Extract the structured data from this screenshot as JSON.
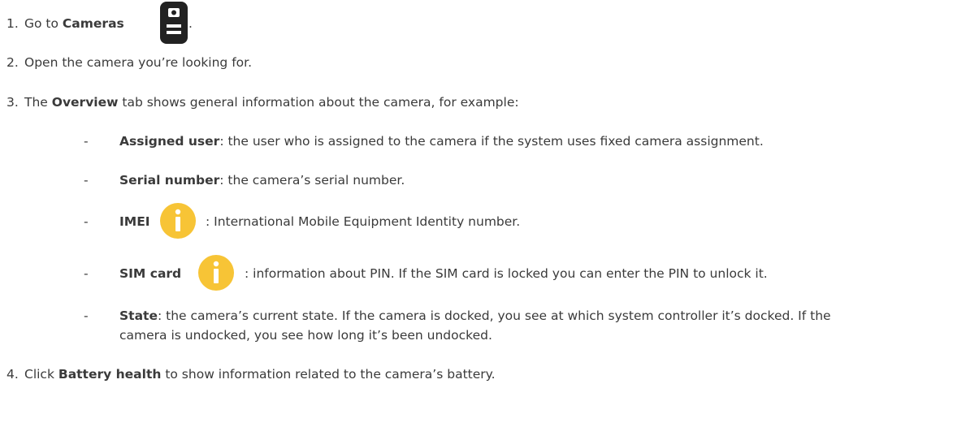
{
  "steps": [
    {
      "num": "1.",
      "pre": "Go to ",
      "bold": "Cameras",
      "post": " ."
    },
    {
      "num": "2.",
      "text": "Open the camera you’re looking for."
    },
    {
      "num": "3.",
      "pre": "The ",
      "bold": "Overview",
      "post": " tab shows general information about the camera, for example:"
    },
    {
      "num": "4.",
      "pre": "Click ",
      "bold": "Battery health",
      "post": " to show information related to the camera’s battery."
    }
  ],
  "items": [
    {
      "dash": "-",
      "bold": "Assigned user",
      "text": ": the user who is assigned to the camera if the system uses fixed camera assignment."
    },
    {
      "dash": "-",
      "bold": "Serial number",
      "text": ": the camera’s serial number."
    },
    {
      "dash": "-",
      "bold": "IMEI",
      "text": ": International Mobile Equipment Identity number."
    },
    {
      "dash": "-",
      "bold": "SIM card",
      "text": ": information about PIN. If the SIM card is locked you can enter the PIN to unlock it."
    },
    {
      "dash": "-",
      "bold": "State",
      "text": ": the camera’s current state. If the camera is docked, you see at which system controller it’s docked. If the",
      "text2": "camera is undocked, you see how long it’s been undocked."
    }
  ],
  "colors": {
    "text": "#3a3a3a",
    "info_icon": "#f7c436",
    "camera_icon": "#222222"
  },
  "icons": {
    "cameras": "camera-device-icon",
    "info": "info-icon"
  }
}
